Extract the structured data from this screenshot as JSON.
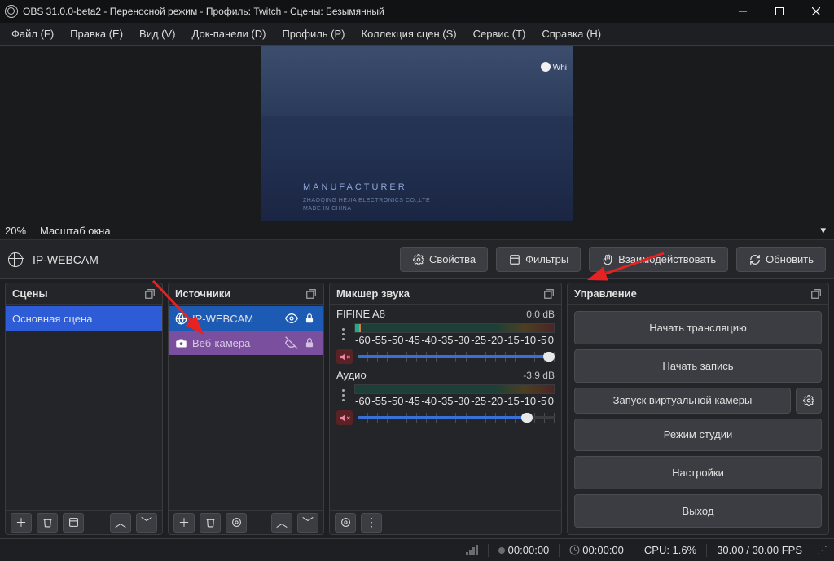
{
  "window": {
    "title": "OBS 31.0.0-beta2 - Переносной режим - Профиль: Twitch - Сцены: Безымянный"
  },
  "menu": {
    "file": "Файл (F)",
    "edit": "Правка (E)",
    "view": "Вид (V)",
    "dock": "Док-панели (D)",
    "profile": "Профиль (P)",
    "scenecol": "Коллекция сцен (S)",
    "service": "Сервис (T)",
    "help": "Справка (H)"
  },
  "preview": {
    "manufacturer": "MANUFACTURER",
    "sub1": "ZHAOQING HEJIA ELECTRONICS CO.,LTE",
    "sub2": "MADE IN CHINA",
    "wh": "Whi"
  },
  "zoom": {
    "percent": "20%",
    "fit": "Масштаб окна"
  },
  "srcbar": {
    "name": "IP-WEBCAM",
    "props": "Свойства",
    "filters": "Фильтры",
    "interact": "Взаимодействовать",
    "refresh": "Обновить"
  },
  "panels": {
    "scenes_title": "Сцены",
    "sources_title": "Источники",
    "mixer_title": "Микшер звука",
    "controls_title": "Управление"
  },
  "scenes": [
    {
      "name": "Основная сцена"
    }
  ],
  "sources": [
    {
      "name": "IP-WEBCAM"
    },
    {
      "name": "Веб-камера"
    }
  ],
  "mixer": {
    "ch1": {
      "name": "FIFINE A8",
      "db": "0.0 dB"
    },
    "ch2": {
      "name": "Аудио",
      "db": "-3.9 dB"
    },
    "scale": [
      "-60",
      "-55",
      "-50",
      "-45",
      "-40",
      "-35",
      "-30",
      "-25",
      "-20",
      "-15",
      "-10",
      "-5",
      "0"
    ]
  },
  "controls": {
    "stream": "Начать трансляцию",
    "record": "Начать запись",
    "vcam": "Запуск виртуальной камеры",
    "studio": "Режим студии",
    "settings": "Настройки",
    "exit": "Выход"
  },
  "status": {
    "rec": "00:00:00",
    "stream": "00:00:00",
    "cpu": "CPU: 1.6%",
    "fps": "30.00 / 30.00 FPS"
  }
}
